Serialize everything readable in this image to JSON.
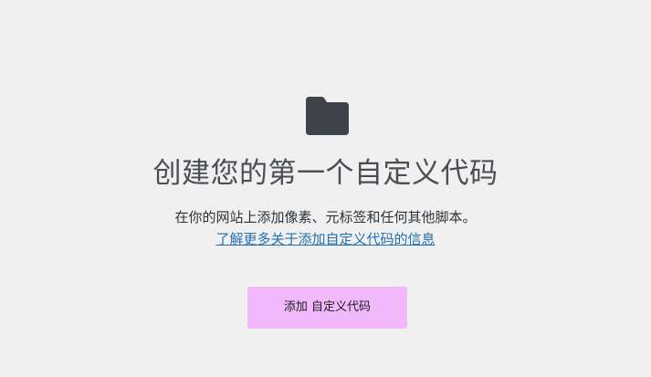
{
  "empty_state": {
    "icon": "folder-icon",
    "title": "创建您的第一个自定义代码",
    "description": "在你的网站上添加像素、元标签和任何其他脚本。",
    "learn_more_link": "了解更多关于添加自定义代码的信息",
    "add_button_label": "添加 自定义代码"
  },
  "colors": {
    "background": "#f0f0f1",
    "icon": "#3c434a",
    "link": "#2271b1",
    "button": "#f1b9fb"
  }
}
